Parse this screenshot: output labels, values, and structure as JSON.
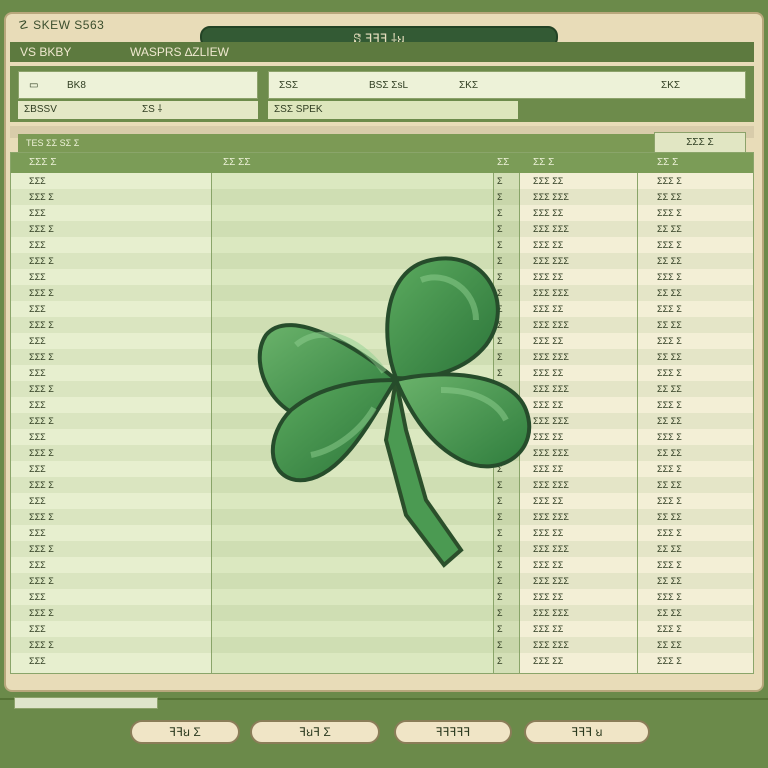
{
  "window": {
    "title": "ꗟ ꟻꟻꟻ ⸸ꞟ",
    "label": "☡ SKEW S563"
  },
  "menubar": {
    "items": [
      "VS BKBY",
      "WASPRS ∆ZLIEW"
    ]
  },
  "toolbar": {
    "left_text": "BK8",
    "left_sub": "ƩBSSV",
    "left_sub_extra": "ƩS ⸸",
    "right_texts": [
      "ƩSƩ",
      "BSƩ ƩsL",
      "ƩKƩ",
      "ƩKƩ"
    ],
    "right_sub": "ƩSƩ SPEK"
  },
  "subheader": {
    "label": "TES ƩƩ SƩ Ʃ",
    "chip": "ƩƩƩ Ʃ"
  },
  "table": {
    "headers": [
      "ƩƩƩ Ʃ",
      "ƩƩ ƩƩ",
      "ƩƩ",
      "ƩƩ Ʃ",
      "ƩƩ Ʃ"
    ]
  },
  "rows": [
    [
      "ƩƩƩ",
      "",
      "Ʃ",
      "ƩƩƩ ƩƩ",
      "ƩƩƩ Ʃ"
    ],
    [
      "ƩƩƩ Ʃ",
      "",
      "Ʃ",
      "ƩƩƩ ƩƩƩ",
      "ƩƩ ƩƩ"
    ],
    [
      "ƩƩƩ",
      "",
      "Ʃ",
      "ƩƩƩ ƩƩ",
      "ƩƩƩ Ʃ"
    ],
    [
      "ƩƩƩ Ʃ",
      "",
      "Ʃ",
      "ƩƩƩ ƩƩƩ",
      "ƩƩ ƩƩ"
    ],
    [
      "ƩƩƩ",
      "",
      "Ʃ",
      "ƩƩƩ ƩƩ",
      "ƩƩƩ Ʃ"
    ],
    [
      "ƩƩƩ Ʃ",
      "",
      "Ʃ",
      "ƩƩƩ ƩƩƩ",
      "ƩƩ ƩƩ"
    ],
    [
      "ƩƩƩ",
      "",
      "Ʃ",
      "ƩƩƩ ƩƩ",
      "ƩƩƩ Ʃ"
    ],
    [
      "ƩƩƩ Ʃ",
      "",
      "Ʃ",
      "ƩƩƩ ƩƩƩ",
      "ƩƩ ƩƩ"
    ],
    [
      "ƩƩƩ",
      "",
      "Ʃ",
      "ƩƩƩ ƩƩ",
      "ƩƩƩ Ʃ"
    ],
    [
      "ƩƩƩ Ʃ",
      "",
      "Ʃ",
      "ƩƩƩ ƩƩƩ",
      "ƩƩ ƩƩ"
    ],
    [
      "ƩƩƩ",
      "",
      "Ʃ",
      "ƩƩƩ ƩƩ",
      "ƩƩƩ Ʃ"
    ],
    [
      "ƩƩƩ Ʃ",
      "",
      "Ʃ",
      "ƩƩƩ ƩƩƩ",
      "ƩƩ ƩƩ"
    ],
    [
      "ƩƩƩ",
      "",
      "Ʃ",
      "ƩƩƩ ƩƩ",
      "ƩƩƩ Ʃ"
    ],
    [
      "ƩƩƩ Ʃ",
      "",
      "Ʃ",
      "ƩƩƩ ƩƩƩ",
      "ƩƩ ƩƩ"
    ],
    [
      "ƩƩƩ",
      "",
      "Ʃ",
      "ƩƩƩ ƩƩ",
      "ƩƩƩ Ʃ"
    ],
    [
      "ƩƩƩ Ʃ",
      "",
      "Ʃ",
      "ƩƩƩ ƩƩƩ",
      "ƩƩ ƩƩ"
    ],
    [
      "ƩƩƩ",
      "",
      "Ʃ",
      "ƩƩƩ ƩƩ",
      "ƩƩƩ Ʃ"
    ],
    [
      "ƩƩƩ Ʃ",
      "",
      "Ʃ",
      "ƩƩƩ ƩƩƩ",
      "ƩƩ ƩƩ"
    ],
    [
      "ƩƩƩ",
      "",
      "Ʃ",
      "ƩƩƩ ƩƩ",
      "ƩƩƩ Ʃ"
    ],
    [
      "ƩƩƩ Ʃ",
      "",
      "Ʃ",
      "ƩƩƩ ƩƩƩ",
      "ƩƩ ƩƩ"
    ],
    [
      "ƩƩƩ",
      "",
      "Ʃ",
      "ƩƩƩ ƩƩ",
      "ƩƩƩ Ʃ"
    ],
    [
      "ƩƩƩ Ʃ",
      "",
      "Ʃ",
      "ƩƩƩ ƩƩƩ",
      "ƩƩ ƩƩ"
    ],
    [
      "ƩƩƩ",
      "",
      "Ʃ",
      "ƩƩƩ ƩƩ",
      "ƩƩƩ Ʃ"
    ],
    [
      "ƩƩƩ Ʃ",
      "",
      "Ʃ",
      "ƩƩƩ ƩƩƩ",
      "ƩƩ ƩƩ"
    ],
    [
      "ƩƩƩ",
      "",
      "Ʃ",
      "ƩƩƩ ƩƩ",
      "ƩƩƩ Ʃ"
    ],
    [
      "ƩƩƩ Ʃ",
      "",
      "Ʃ",
      "ƩƩƩ ƩƩƩ",
      "ƩƩ ƩƩ"
    ],
    [
      "ƩƩƩ",
      "",
      "Ʃ",
      "ƩƩƩ ƩƩ",
      "ƩƩƩ Ʃ"
    ],
    [
      "ƩƩƩ Ʃ",
      "",
      "Ʃ",
      "ƩƩƩ ƩƩƩ",
      "ƩƩ ƩƩ"
    ],
    [
      "ƩƩƩ",
      "",
      "Ʃ",
      "ƩƩƩ ƩƩ",
      "ƩƩƩ Ʃ"
    ],
    [
      "ƩƩƩ Ʃ",
      "",
      "Ʃ",
      "ƩƩƩ ƩƩƩ",
      "ƩƩ ƩƩ"
    ],
    [
      "ƩƩƩ",
      "",
      "Ʃ",
      "ƩƩƩ ƩƩ",
      "ƩƩƩ Ʃ"
    ]
  ],
  "footer": {
    "buttons": [
      "ꟻꟻꞟ Ʃ",
      "ꟻꞟꟻ Ʃ",
      "ꟻꟻꟻꟻꟻ",
      "ꟻꟻꟻ ꞟ"
    ]
  },
  "colors": {
    "background": "#6b8a4a",
    "accent": "#7b9c57",
    "panel": "#e8dcb8"
  },
  "icons": [
    "clover-icon"
  ]
}
